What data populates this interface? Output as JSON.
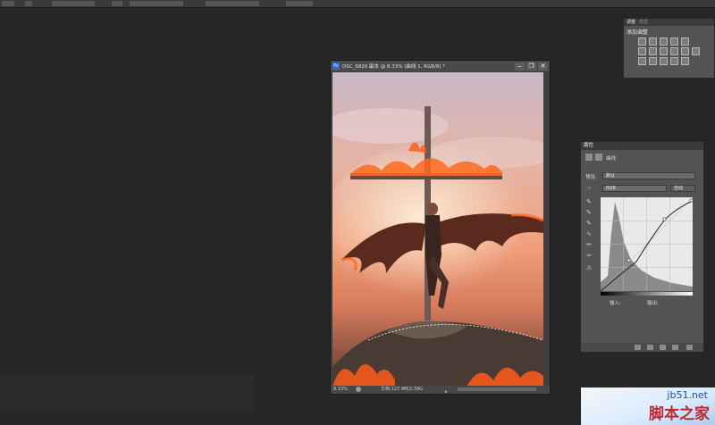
{
  "adjustments_panel": {
    "tabs": [
      "调整",
      "样式"
    ],
    "title": "添加调整"
  },
  "document": {
    "title": "DSC_6820 副本 @ 8.33% (曲线 1, RGB/8) *",
    "ps_badge": "Ps",
    "controls": [
      "‒",
      "❐",
      "✕"
    ],
    "zoom": "8.33%",
    "doc_size": "文档:127.4M/2.39G"
  },
  "properties_panel": {
    "header": "属性",
    "layer_type": "曲线",
    "preset_label": "预设:",
    "preset_value": "默认",
    "channel_value": "RGB",
    "auto_button": "自动",
    "input_label": "输入:",
    "output_label": "输出:"
  },
  "watermark": {
    "domain": "jb51.net",
    "name": "脚本之家"
  },
  "colors": {
    "accent_blue": "#2e6fbf",
    "panel_bg": "#535353",
    "workspace_bg": "#262626"
  }
}
